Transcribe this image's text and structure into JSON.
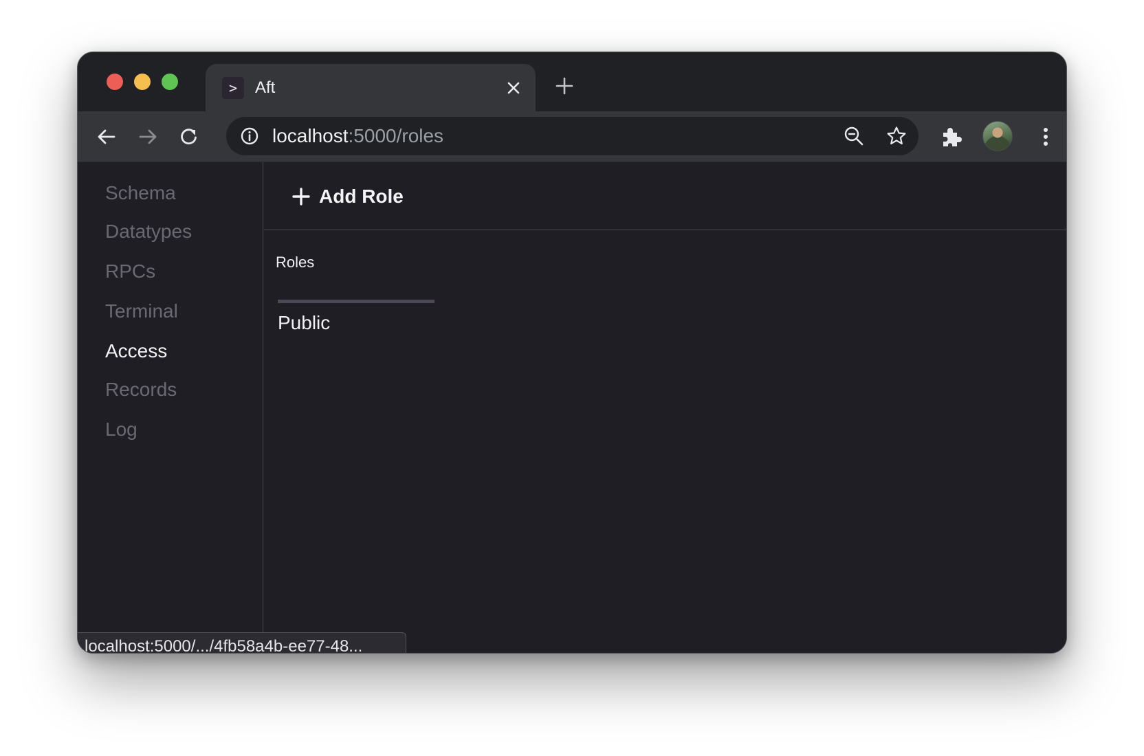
{
  "browser": {
    "tab": {
      "favicon_text": ">",
      "title": "Aft",
      "close_icon": "close-icon"
    },
    "new_tab_icon": "plus-icon",
    "nav": {
      "back_icon": "arrow-left-icon",
      "forward_icon": "arrow-right-icon",
      "reload_icon": "reload-icon"
    },
    "omnibox": {
      "info_icon": "info-icon",
      "host": "localhost",
      "path": ":5000/roles",
      "zoom_icon": "zoom-out-icon",
      "bookmark_icon": "star-icon"
    },
    "extensions_icon": "puzzle-icon",
    "menu_icon": "kebab-menu-icon",
    "status_url": "localhost:5000/.../4fb58a4b-ee77-48..."
  },
  "sidebar": {
    "items": [
      {
        "label": "Schema",
        "active": false
      },
      {
        "label": "Datatypes",
        "active": false
      },
      {
        "label": "RPCs",
        "active": false
      },
      {
        "label": "Terminal",
        "active": false
      },
      {
        "label": "Access",
        "active": true
      },
      {
        "label": "Records",
        "active": false
      },
      {
        "label": "Log",
        "active": false
      }
    ]
  },
  "main": {
    "add_role_label": "Add Role",
    "section_label": "Roles",
    "roles": [
      {
        "name": "Public"
      }
    ]
  },
  "colors": {
    "window_bg": "#1f1e24",
    "toolbar_bg": "#35363a",
    "nav_inactive": "#6a6872",
    "nav_active": "#f4f4f6",
    "card_accent": "#4d4757"
  }
}
